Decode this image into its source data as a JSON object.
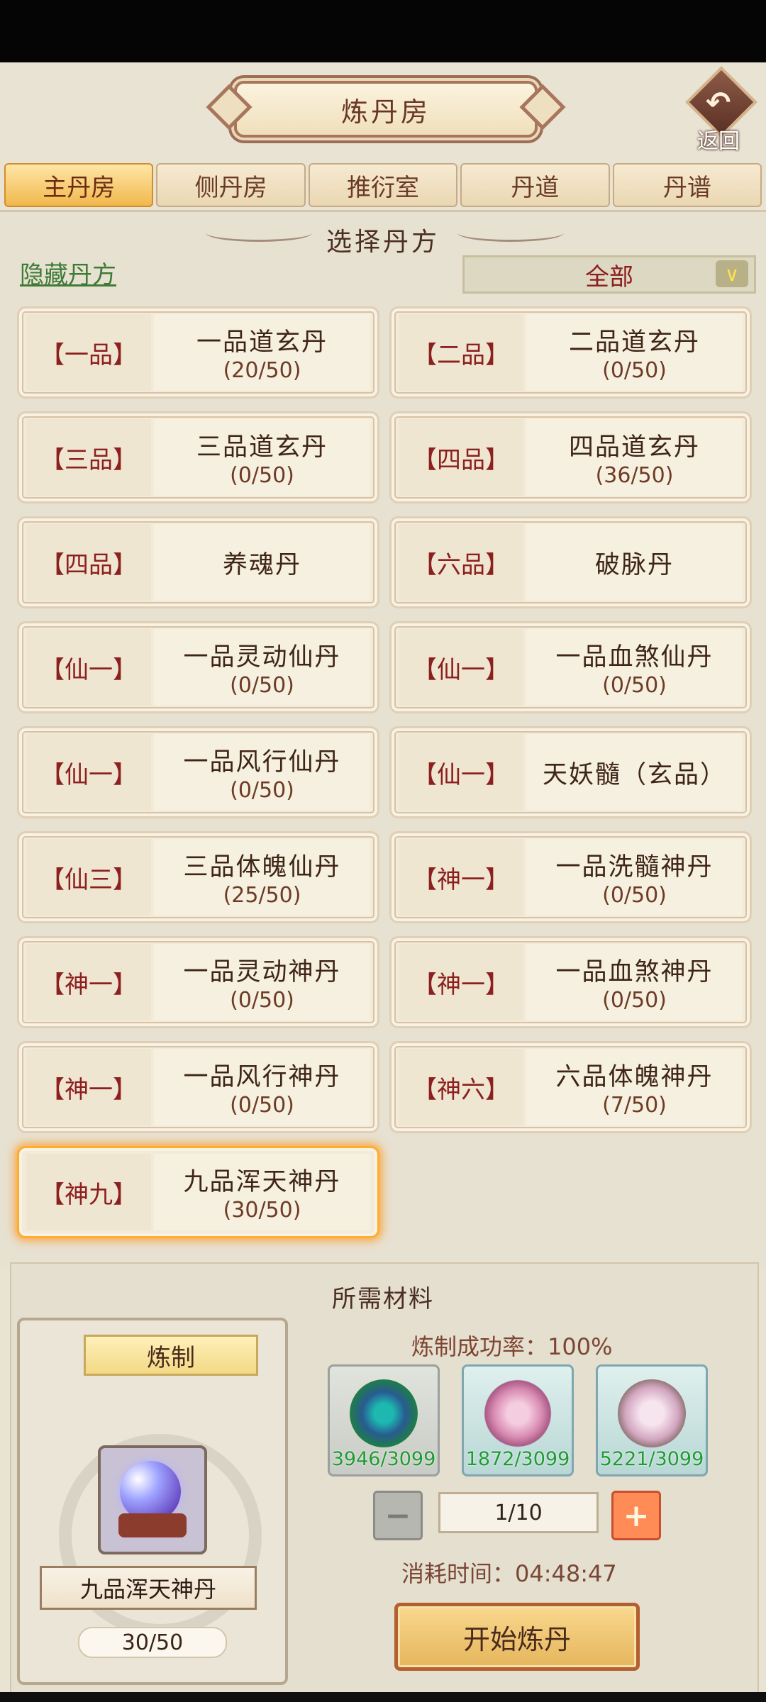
{
  "header": {
    "title": "炼丹房",
    "back_label": "返回"
  },
  "tabs": [
    {
      "label": "主丹房"
    },
    {
      "label": "侧丹房"
    },
    {
      "label": "推衍室"
    },
    {
      "label": "丹道"
    },
    {
      "label": "丹谱"
    }
  ],
  "recipes_panel": {
    "title": "选择丹方",
    "hide_link": "隐藏丹方",
    "filter_value": "全部",
    "items": [
      {
        "grade": "【一品】",
        "name": "一品道玄丹",
        "progress": "(20/50)"
      },
      {
        "grade": "【二品】",
        "name": "二品道玄丹",
        "progress": "(0/50)"
      },
      {
        "grade": "【三品】",
        "name": "三品道玄丹",
        "progress": "(0/50)"
      },
      {
        "grade": "【四品】",
        "name": "四品道玄丹",
        "progress": "(36/50)"
      },
      {
        "grade": "【四品】",
        "name": "养魂丹",
        "progress": ""
      },
      {
        "grade": "【六品】",
        "name": "破脉丹",
        "progress": ""
      },
      {
        "grade": "【仙一】",
        "name": "一品灵动仙丹",
        "progress": "(0/50)"
      },
      {
        "grade": "【仙一】",
        "name": "一品血煞仙丹",
        "progress": "(0/50)"
      },
      {
        "grade": "【仙一】",
        "name": "一品风行仙丹",
        "progress": "(0/50)"
      },
      {
        "grade": "【仙一】",
        "name": "天妖髓（玄品）",
        "progress": ""
      },
      {
        "grade": "【仙三】",
        "name": "三品体魄仙丹",
        "progress": "(25/50)"
      },
      {
        "grade": "【神一】",
        "name": "一品洗髓神丹",
        "progress": "(0/50)"
      },
      {
        "grade": "【神一】",
        "name": "一品灵动神丹",
        "progress": "(0/50)"
      },
      {
        "grade": "【神一】",
        "name": "一品血煞神丹",
        "progress": "(0/50)"
      },
      {
        "grade": "【神一】",
        "name": "一品风行神丹",
        "progress": "(0/50)"
      },
      {
        "grade": "【神六】",
        "name": "六品体魄神丹",
        "progress": "(7/50)"
      },
      {
        "grade": "【神九】",
        "name": "九品浑天神丹",
        "progress": "(30/50)"
      }
    ]
  },
  "materials": {
    "title": "所需材料",
    "craft_label": "炼制",
    "selected_item_name": "九品浑天神丹",
    "selected_item_count": "30/50",
    "success_rate": "炼制成功率：100%",
    "items": [
      {
        "icon": "tree-herb-icon",
        "quantity": "3946/3099"
      },
      {
        "icon": "flower-herb-icon",
        "quantity": "1872/3099"
      },
      {
        "icon": "feather-herb-icon",
        "quantity": "5221/3099"
      }
    ],
    "quantity_value": "1/10",
    "time_text": "消耗时间：04:48:47",
    "start_button": "开始炼丹"
  }
}
